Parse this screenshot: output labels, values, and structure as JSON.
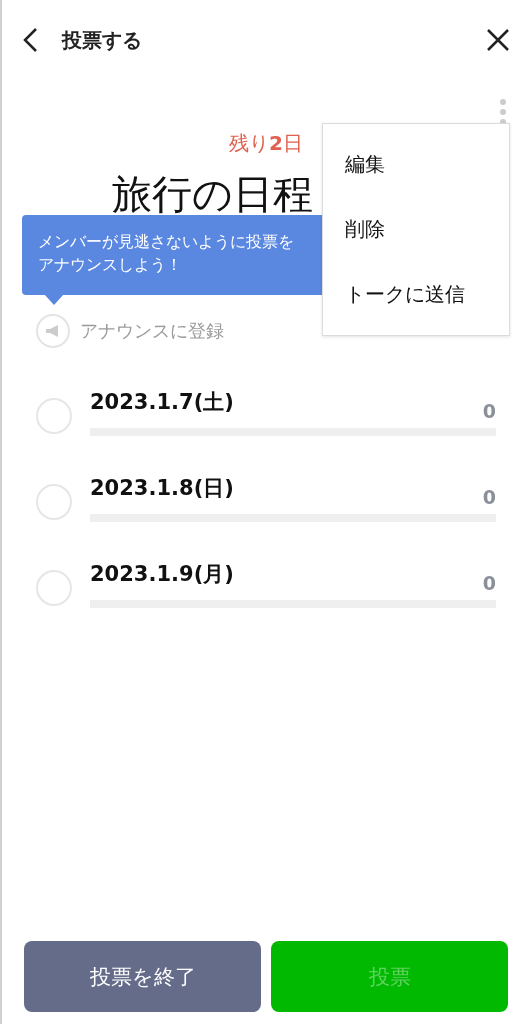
{
  "header": {
    "title": "投票する"
  },
  "poll": {
    "remaining": "残り**2**日",
    "title": "旅行の日程"
  },
  "tooltip": {
    "lines": [
      "メンバーが見逃さないように投票を",
      "アナウンスしよう！"
    ]
  },
  "announce": {
    "label": "アナウンスに登録"
  },
  "options": [
    {
      "label": "2023.1.7(土)",
      "count": "0",
      "selected": false,
      "level": 0
    },
    {
      "label": "2023.1.8(日)",
      "count": "0",
      "selected": false,
      "level": 0
    },
    {
      "label": "2023.1.9(月)",
      "count": "0",
      "selected": false,
      "level": 0
    }
  ],
  "menu": {
    "items": [
      "編集",
      "削除",
      "トークに送信"
    ]
  },
  "buttons": [
    {
      "label": "投票を終了",
      "kind": "end",
      "disabled": false
    },
    {
      "label": "投票",
      "kind": "vote",
      "disabled": true
    }
  ]
}
